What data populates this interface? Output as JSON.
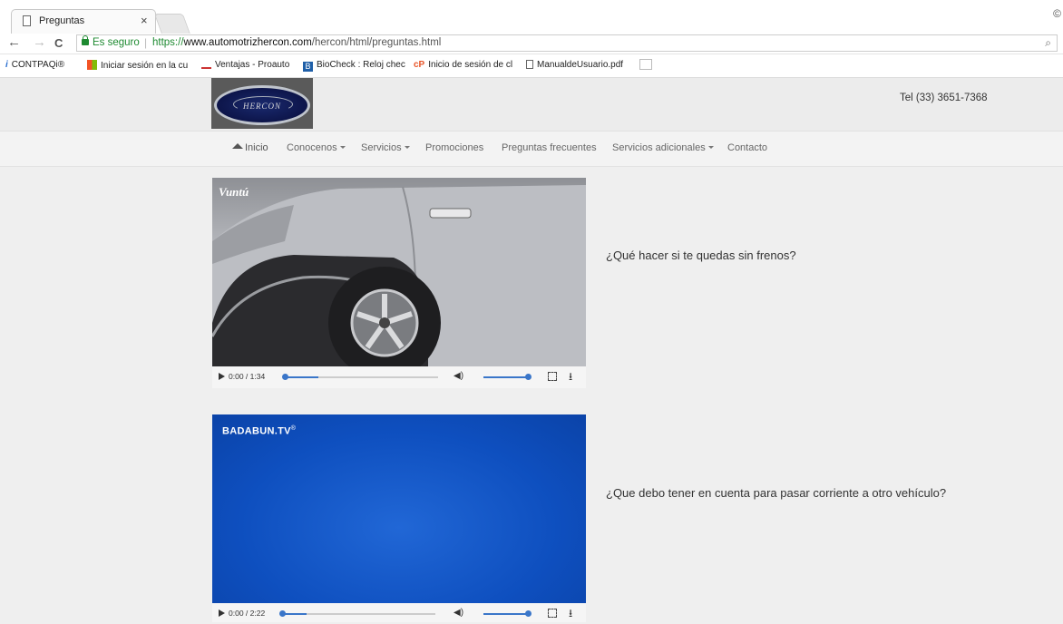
{
  "browser": {
    "tab_title": "Preguntas",
    "tab_close": "×",
    "secure_label": "Es seguro",
    "url_scheme": "https://",
    "url_host": "www.automotrizhercon.com",
    "url_path": "/hercon/html/preguntas.html",
    "nav_back": "←",
    "nav_forward": "→",
    "nav_reload": "C",
    "zoom_icon": "🔍",
    "bookmarks": [
      {
        "label": "CONTPAQi®"
      },
      {
        "label": "Iniciar sesión en la cu"
      },
      {
        "label": "Ventajas - Proauto"
      },
      {
        "label": "BioCheck : Reloj chec"
      },
      {
        "label": "Inicio de sesión de cl"
      },
      {
        "label": "ManualdeUsuario.pdf"
      }
    ]
  },
  "site": {
    "logo_text": "HERCON",
    "telephone": "Tel (33) 3651-7368",
    "nav": [
      {
        "label": "Inicio"
      },
      {
        "label": "Conocenos"
      },
      {
        "label": "Servicios"
      },
      {
        "label": "Promociones"
      },
      {
        "label": "Preguntas frecuentes"
      },
      {
        "label": "Servicios adicionales"
      },
      {
        "label": "Contacto"
      }
    ]
  },
  "videos": [
    {
      "watermark": "Vuntú",
      "time": "0:00 / 1:34",
      "question": "¿Qué hacer si te quedas sin frenos?"
    },
    {
      "watermark": "BADABUN.TV",
      "watermark_mark": "®",
      "time": "0:00 / 2:22",
      "question": "¿Que debo tener en cuenta para pasar corriente a otro vehículo?"
    }
  ],
  "colors": {
    "accent_blue": "#3a76c9",
    "secure_green": "#1e8a31",
    "video2_bg": "#0e4fbf"
  }
}
